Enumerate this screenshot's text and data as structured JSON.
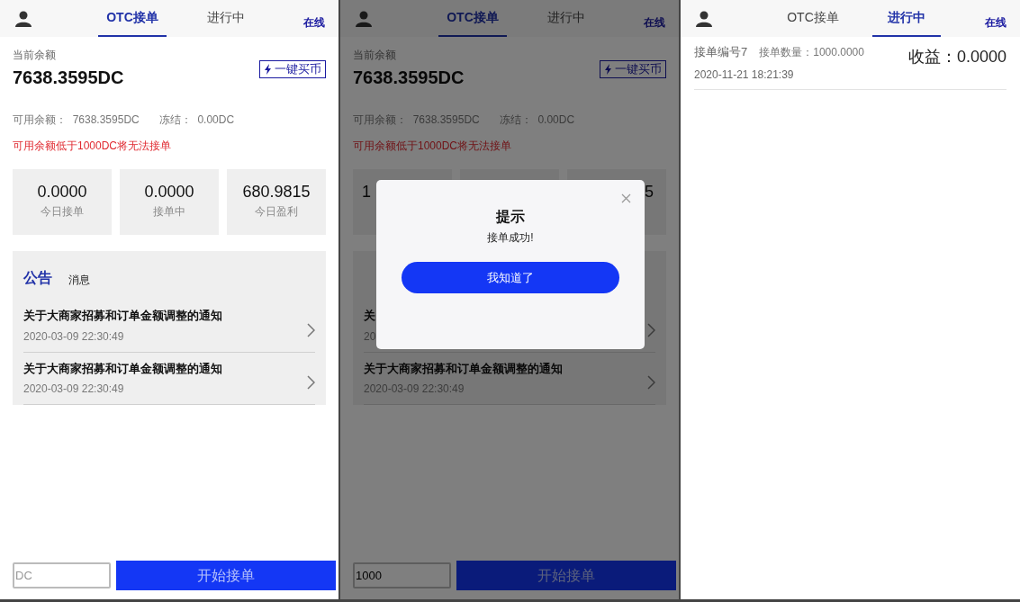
{
  "screens": [
    {
      "kind": "home",
      "header": {
        "tabs": [
          {
            "label": "OTC接单",
            "selected": true
          },
          {
            "label": "进行中",
            "selected": false
          }
        ],
        "status": "在线"
      },
      "balance_label": "当前余额",
      "balance": "7638.3595DC",
      "buy_button": "一键买币",
      "available": "可用余额：  7638.3595DC",
      "frozen": "冻结：  0.00DC",
      "warning": "可用余额低于1000DC将无法接单",
      "stats": [
        {
          "kind": "full",
          "value": "0.0000",
          "label": "今日接单"
        },
        {
          "kind": "full",
          "value": "0.0000",
          "label": "接单中"
        },
        {
          "kind": "full",
          "value": "680.9815",
          "label": "今日盈利"
        }
      ],
      "notice_tabs": [
        {
          "label": "公告",
          "selected": true
        },
        {
          "label": "消息",
          "selected": false
        }
      ],
      "notices": [
        {
          "title": "关于大商家招募和订单金额调整的通知",
          "date": "2020-03-09 22:30:49"
        },
        {
          "title": "关于大商家招募和订单金额调整的通知",
          "date": "2020-03-09 22:30:49"
        }
      ],
      "amount_field": {
        "placeholder": "DC"
      },
      "start_button": "开始接单"
    },
    {
      "kind": "home",
      "header": {
        "tabs": [
          {
            "label": "OTC接单",
            "selected": true
          },
          {
            "label": "进行中",
            "selected": false
          }
        ],
        "status": "在线"
      },
      "balance_label": "当前余额",
      "balance": "7638.3595DC",
      "buy_button": "一键买币",
      "available": "可用余额：  7638.3595DC",
      "frozen": "冻结：  0.00DC",
      "warning": "可用余额低于1000DC将无法接单",
      "stats": [
        {
          "kind": "start",
          "value": "1"
        },
        {
          "kind": "covered"
        },
        {
          "kind": "end",
          "value": "5"
        }
      ],
      "notices": [
        {
          "title": "关",
          "date": "20"
        },
        {
          "title": "关于大商家招募和订单金额调整的通知",
          "date": "2020-03-09 22:30:49"
        }
      ],
      "amount_field": {
        "value": "1000"
      },
      "start_button": "开始接单",
      "dialog": {
        "title": "提示",
        "message": "接单成功!",
        "button": "我知道了"
      }
    },
    {
      "kind": "orders",
      "header": {
        "tabs": [
          {
            "label": "OTC接单",
            "selected": false
          },
          {
            "label": "进行中",
            "selected": true
          }
        ],
        "status": "在线"
      },
      "orders": [
        {
          "number": "接单编号7",
          "quantity": "接单数量：1000.0000",
          "date": "2020-11-21 18:21:39",
          "profit": "收益：0.0000"
        }
      ]
    }
  ]
}
